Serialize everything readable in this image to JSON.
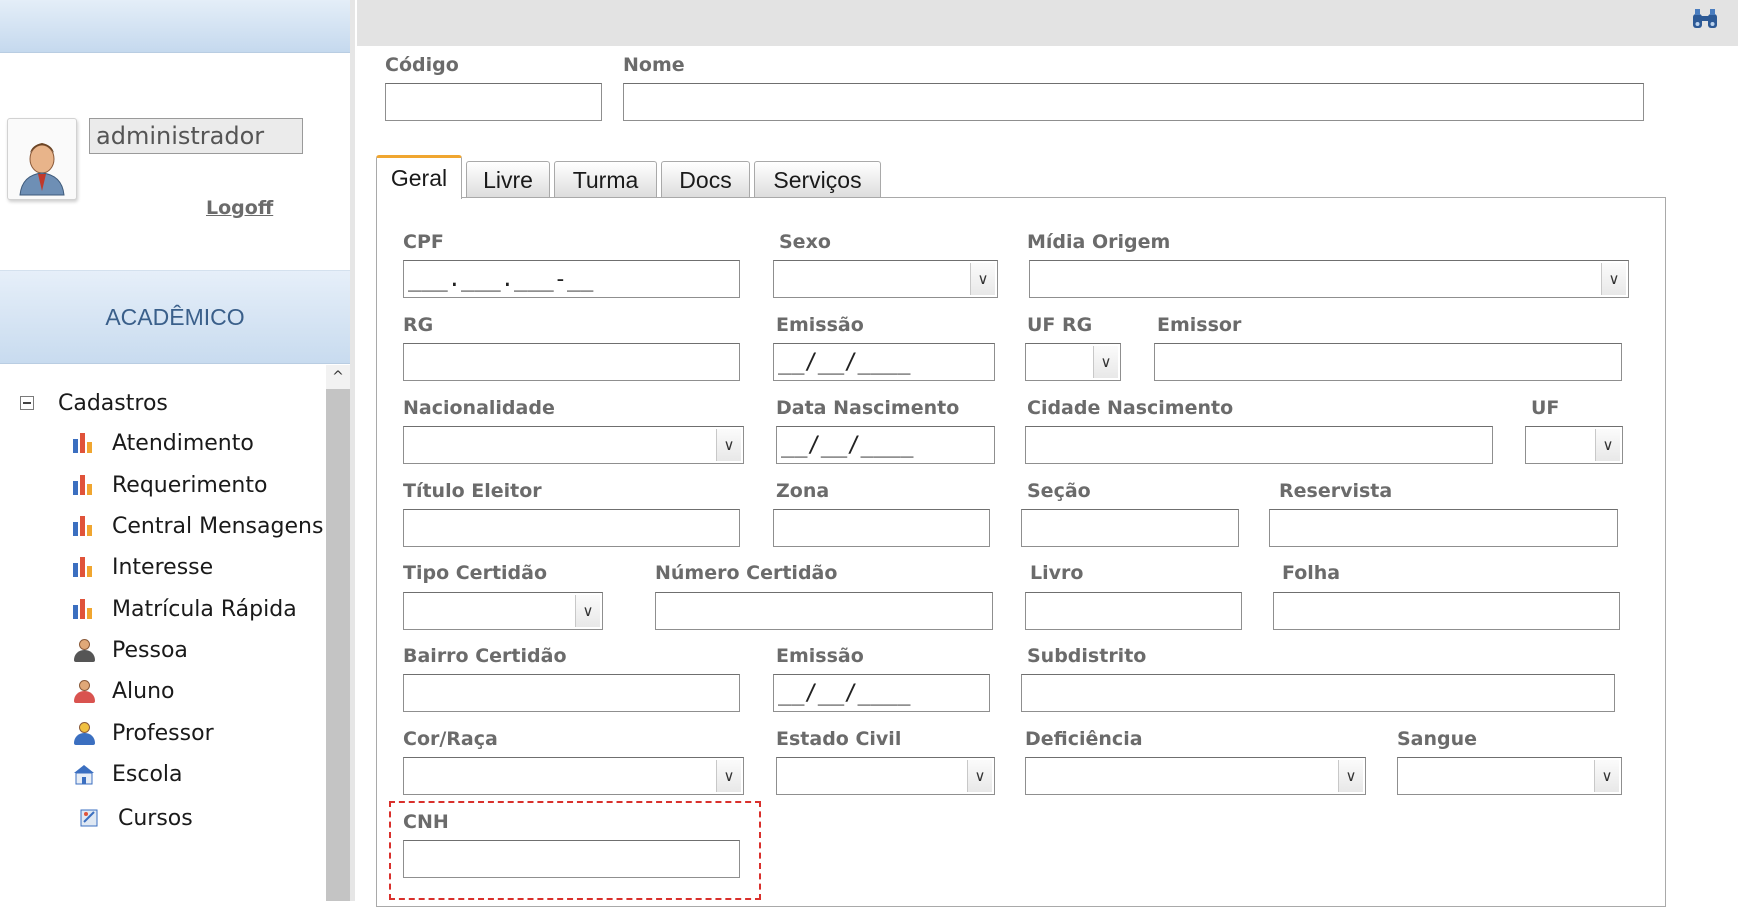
{
  "sidebar": {
    "username": "administrador",
    "logoff_label": "Logoff",
    "module_title": "ACADÊMICO",
    "group_label": "Cadastros",
    "items": [
      {
        "label": "Atendimento",
        "icon": "bar-chart-icon"
      },
      {
        "label": "Requerimento",
        "icon": "bar-chart-icon"
      },
      {
        "label": "Central Mensagens",
        "icon": "bar-chart-icon"
      },
      {
        "label": "Interesse",
        "icon": "bar-chart-icon"
      },
      {
        "label": "Matrícula Rápida",
        "icon": "bar-chart-icon"
      },
      {
        "label": "Pessoa",
        "icon": "person-icon"
      },
      {
        "label": "Aluno",
        "icon": "student-icon"
      },
      {
        "label": "Professor",
        "icon": "teacher-icon"
      },
      {
        "label": "Escola",
        "icon": "school-icon"
      },
      {
        "label": "Cursos",
        "icon": "courses-icon"
      }
    ]
  },
  "toolbar": {
    "search_icon": "binoculars-icon"
  },
  "header_fields": {
    "codigo_label": "Código",
    "nome_label": "Nome"
  },
  "tabs": [
    {
      "label": "Geral",
      "active": true
    },
    {
      "label": "Livre"
    },
    {
      "label": "Turma"
    },
    {
      "label": "Docs"
    },
    {
      "label": "Serviços"
    }
  ],
  "form": {
    "cpf_label": "CPF",
    "cpf_mask": "___.___.___-__",
    "sexo_label": "Sexo",
    "midia_label": "Mídia Origem",
    "rg_label": "RG",
    "emissao_label": "Emissão",
    "date_mask": "__/__/____",
    "uf_rg_label": "UF RG",
    "emissor_label": "Emissor",
    "nacionalidade_label": "Nacionalidade",
    "data_nasc_label": "Data Nascimento",
    "cidade_nasc_label": "Cidade Nascimento",
    "uf_label": "UF",
    "titulo_label": "Título Eleitor",
    "zona_label": "Zona",
    "secao_label": "Seção",
    "reservista_label": "Reservista",
    "tipo_cert_label": "Tipo Certidão",
    "numero_cert_label": "Número Certidão",
    "livro_label": "Livro",
    "folha_label": "Folha",
    "bairro_cert_label": "Bairro Certidão",
    "emissao2_label": "Emissão",
    "subdistrito_label": "Subdistrito",
    "cor_label": "Cor/Raça",
    "estado_civil_label": "Estado Civil",
    "deficiencia_label": "Deficiência",
    "sangue_label": "Sangue",
    "cnh_label": "CNH"
  },
  "colors": {
    "tab_accent": "#f0a630",
    "highlight": "#d9302c",
    "label": "#6b6b6b",
    "module_text": "#3a5f8a"
  }
}
